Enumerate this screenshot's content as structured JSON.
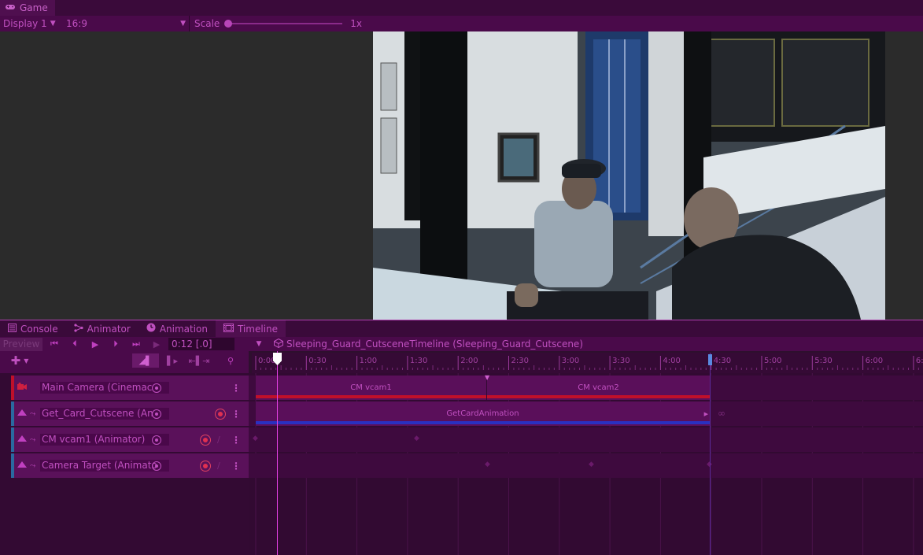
{
  "game": {
    "tab_label": "Game",
    "display": "Display 1",
    "aspect": "16:9",
    "scale_label": "Scale",
    "scale_value": "1x"
  },
  "panel_tabs": [
    {
      "label": "Console",
      "icon": "console-icon"
    },
    {
      "label": "Animator",
      "icon": "animator-icon"
    },
    {
      "label": "Animation",
      "icon": "animation-clock-icon"
    },
    {
      "label": "Timeline",
      "icon": "timeline-film-icon"
    }
  ],
  "timeline": {
    "preview_label": "Preview",
    "time": "0:12 [.0]",
    "asset": "Sleeping_Guard_CutsceneTimeline (Sleeping_Guard_Cutscene)",
    "ruler_labels": [
      "0:00",
      "0:30",
      "1:00",
      "1:30",
      "2:00",
      "2:30",
      "3:00",
      "3:30",
      "4:00",
      "4:30",
      "5:00",
      "5:30",
      "6:00",
      "6:"
    ],
    "tracks": [
      {
        "name": "Main Camera (Cinemac",
        "color": "#c0102a"
      },
      {
        "name": "Get_Card_Cutscene (An",
        "color": "#2a6aa0"
      },
      {
        "name": "CM vcam1 (Animator)",
        "color": "#2a6aa0"
      },
      {
        "name": "Camera Target (Animato",
        "color": "#2a6aa0"
      }
    ],
    "clips": {
      "cm_vcam1": "CM vcam1",
      "cm_vcam2": "CM vcam2",
      "get_card": "GetCardAnimation"
    },
    "colors": {
      "cinemachine_bar": "#c0102a",
      "animation_bar": "#2a30c0",
      "accent": "#b845b8"
    }
  }
}
